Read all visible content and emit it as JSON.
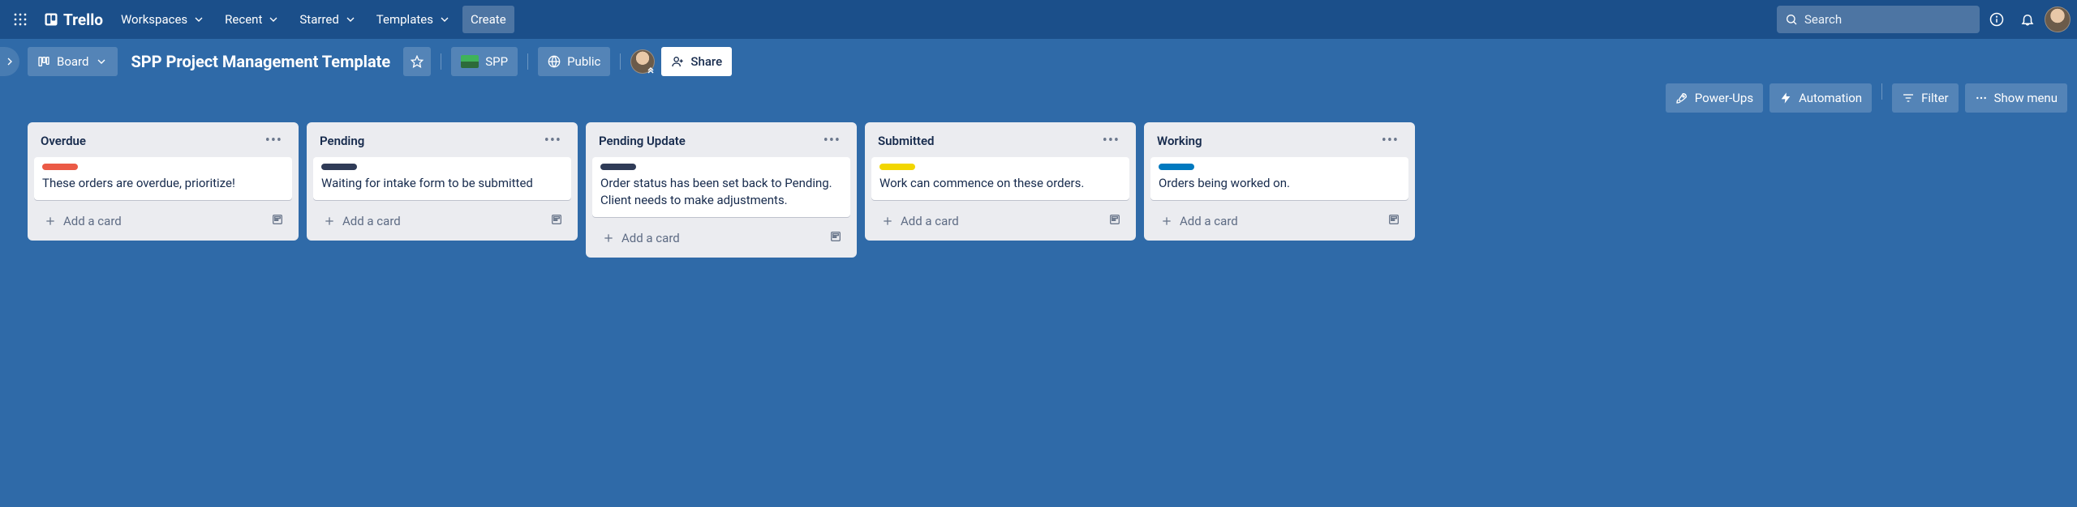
{
  "topnav": {
    "logo_text": "Trello",
    "menus": [
      {
        "label": "Workspaces"
      },
      {
        "label": "Recent"
      },
      {
        "label": "Starred"
      },
      {
        "label": "Templates"
      }
    ],
    "create_label": "Create",
    "search_placeholder": "Search"
  },
  "board_header": {
    "view_switch_label": "Board",
    "board_title": "SPP Project Management Template",
    "workspace_label": "SPP",
    "visibility_label": "Public",
    "share_label": "Share"
  },
  "toolbar": {
    "powerups_label": "Power-Ups",
    "automation_label": "Automation",
    "filter_label": "Filter",
    "show_menu_label": "Show menu"
  },
  "lists": [
    {
      "title": "Overdue",
      "cards": [
        {
          "label_color": "#eb5a46",
          "text": "These orders are overdue, prioritize!"
        }
      ]
    },
    {
      "title": "Pending",
      "cards": [
        {
          "label_color": "#2f3b57",
          "text": "Waiting for intake form to be submitted"
        }
      ]
    },
    {
      "title": "Pending Update",
      "cards": [
        {
          "label_color": "#2f3b57",
          "text": "Order status has been set back to Pending. Client needs to make adjustments."
        }
      ]
    },
    {
      "title": "Submitted",
      "cards": [
        {
          "label_color": "#f2d600",
          "text": "Work can commence on these orders."
        }
      ]
    },
    {
      "title": "Working",
      "cards": [
        {
          "label_color": "#0079bf",
          "text": "Orders being worked on."
        }
      ]
    }
  ],
  "list_footer": {
    "add_card_label": "Add a card"
  }
}
